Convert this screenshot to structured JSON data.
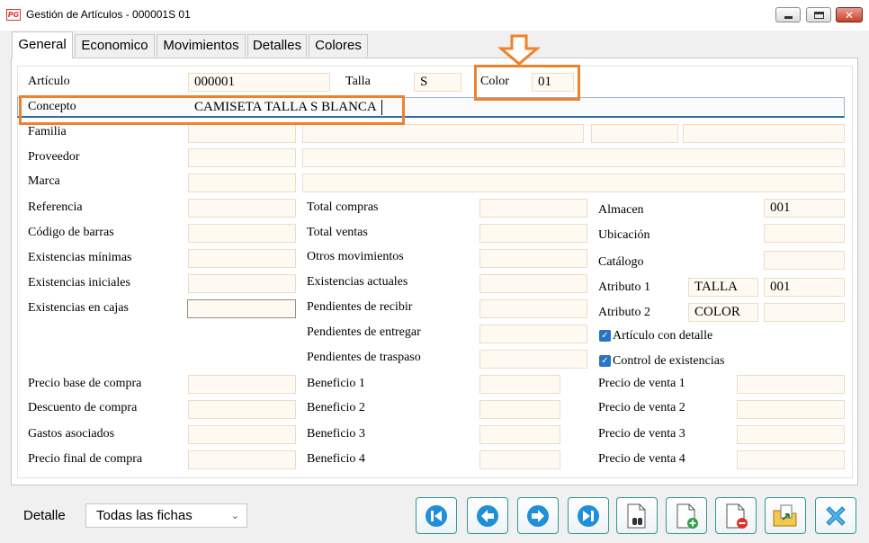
{
  "window": {
    "logo": "PG",
    "title": "Gestión de Artículos - 000001S 01",
    "minimize": "_",
    "maximize": "□",
    "close": "✕"
  },
  "tabs": [
    {
      "label": "General",
      "active": true
    },
    {
      "label": "Economico"
    },
    {
      "label": "Movimientos"
    },
    {
      "label": "Detalles"
    },
    {
      "label": "Colores"
    }
  ],
  "header": {
    "articulo_label": "Artículo",
    "articulo_value": "000001",
    "talla_label": "Talla",
    "talla_value": "S",
    "color_label": "Color",
    "color_value": "01",
    "concepto_label": "Concepto",
    "concepto_value": "CAMISETA TALLA S BLANCA",
    "familia_label": "Familia",
    "proveedor_label": "Proveedor",
    "marca_label": "Marca"
  },
  "col1": {
    "referencia": "Referencia",
    "codigo_barras": "Código de barras",
    "existencias_minimas": "Existencias mínimas",
    "existencias_iniciales": "Existencias iniciales",
    "existencias_cajas": "Existencias en cajas",
    "precio_base": "Precio base de compra",
    "descuento": "Descuento de compra",
    "gastos": "Gastos asociados",
    "precio_final": "Precio final de compra"
  },
  "col2": {
    "total_compras": "Total compras",
    "total_ventas": "Total ventas",
    "otros_movimientos": "Otros movimientos",
    "existencias_actuales": "Existencias actuales",
    "pendientes_recibir": "Pendientes de recibir",
    "pendientes_entregar": "Pendientes de entregar",
    "pendientes_traspaso": "Pendientes de traspaso",
    "beneficio1": "Beneficio 1",
    "beneficio2": "Beneficio 2",
    "beneficio3": "Beneficio 3",
    "beneficio4": "Beneficio 4"
  },
  "col3": {
    "almacen_label": "Almacen",
    "almacen_value": "001",
    "ubicacion": "Ubicación",
    "catalogo": "Catálogo",
    "atributo1_label": "Atributo 1",
    "atributo1_name": "TALLA",
    "atributo1_value": "001",
    "atributo2_label": "Atributo 2",
    "atributo2_name": "COLOR",
    "articulo_con_detalle": "Artículo con detalle",
    "control_existencias": "Control de existencias",
    "check_mark": "✓",
    "precio_venta1": "Precio de venta 1",
    "precio_venta2": "Precio de venta 2",
    "precio_venta3": "Precio de venta 3",
    "precio_venta4": "Precio de venta 4"
  },
  "footer": {
    "detalle_label": "Detalle",
    "detalle_value": "Todas las fichas",
    "chevron": "⌄"
  },
  "buttons": [
    {
      "icon": "first-record-icon"
    },
    {
      "icon": "previous-record-icon"
    },
    {
      "icon": "next-record-icon"
    },
    {
      "icon": "last-record-icon"
    },
    {
      "icon": "search-document-icon"
    },
    {
      "icon": "new-document-icon"
    },
    {
      "icon": "delete-document-icon"
    },
    {
      "icon": "folder-export-icon"
    },
    {
      "icon": "close-x-icon"
    }
  ],
  "colors": {
    "accent": "#2a74c4",
    "highlight": "#f0812a",
    "field_bg": "#fffaf1",
    "nav_border": "#2f9a92"
  }
}
